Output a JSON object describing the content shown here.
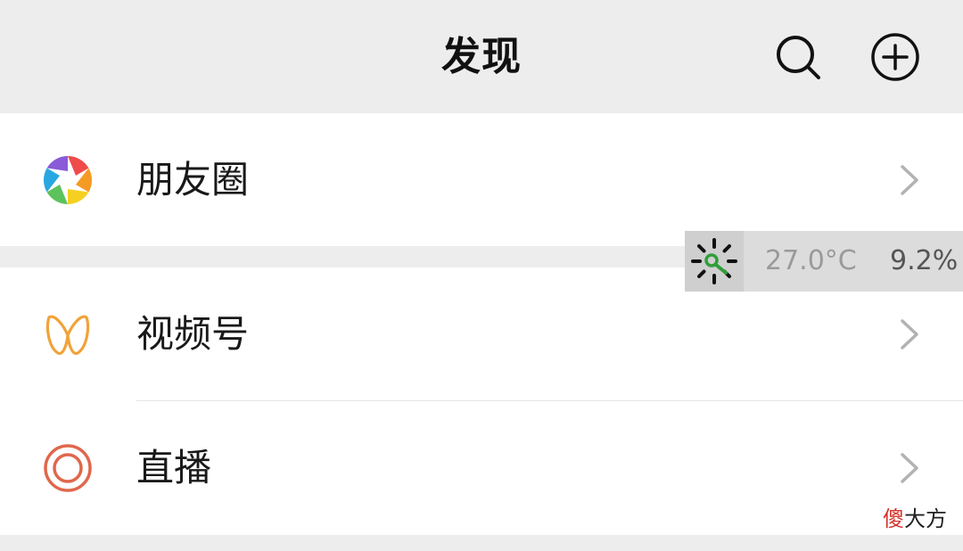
{
  "header": {
    "title": "发现",
    "search_icon": "search-icon",
    "add_icon": "plus-circle-icon"
  },
  "menu": {
    "items": [
      {
        "label": "朋友圈",
        "icon": "moments-aperture-icon"
      },
      {
        "label": "视频号",
        "icon": "channels-icon",
        "icon_color": "#f0a33a"
      },
      {
        "label": "直播",
        "icon": "live-icon",
        "icon_color": "#e0674c"
      }
    ],
    "chevron_icon": "chevron-right-icon"
  },
  "overlay": {
    "temperature": "27.0°C",
    "percent": "9.2%",
    "icon": "sensor-icon"
  },
  "watermark": {
    "char1": "傻",
    "rest": "大方"
  }
}
